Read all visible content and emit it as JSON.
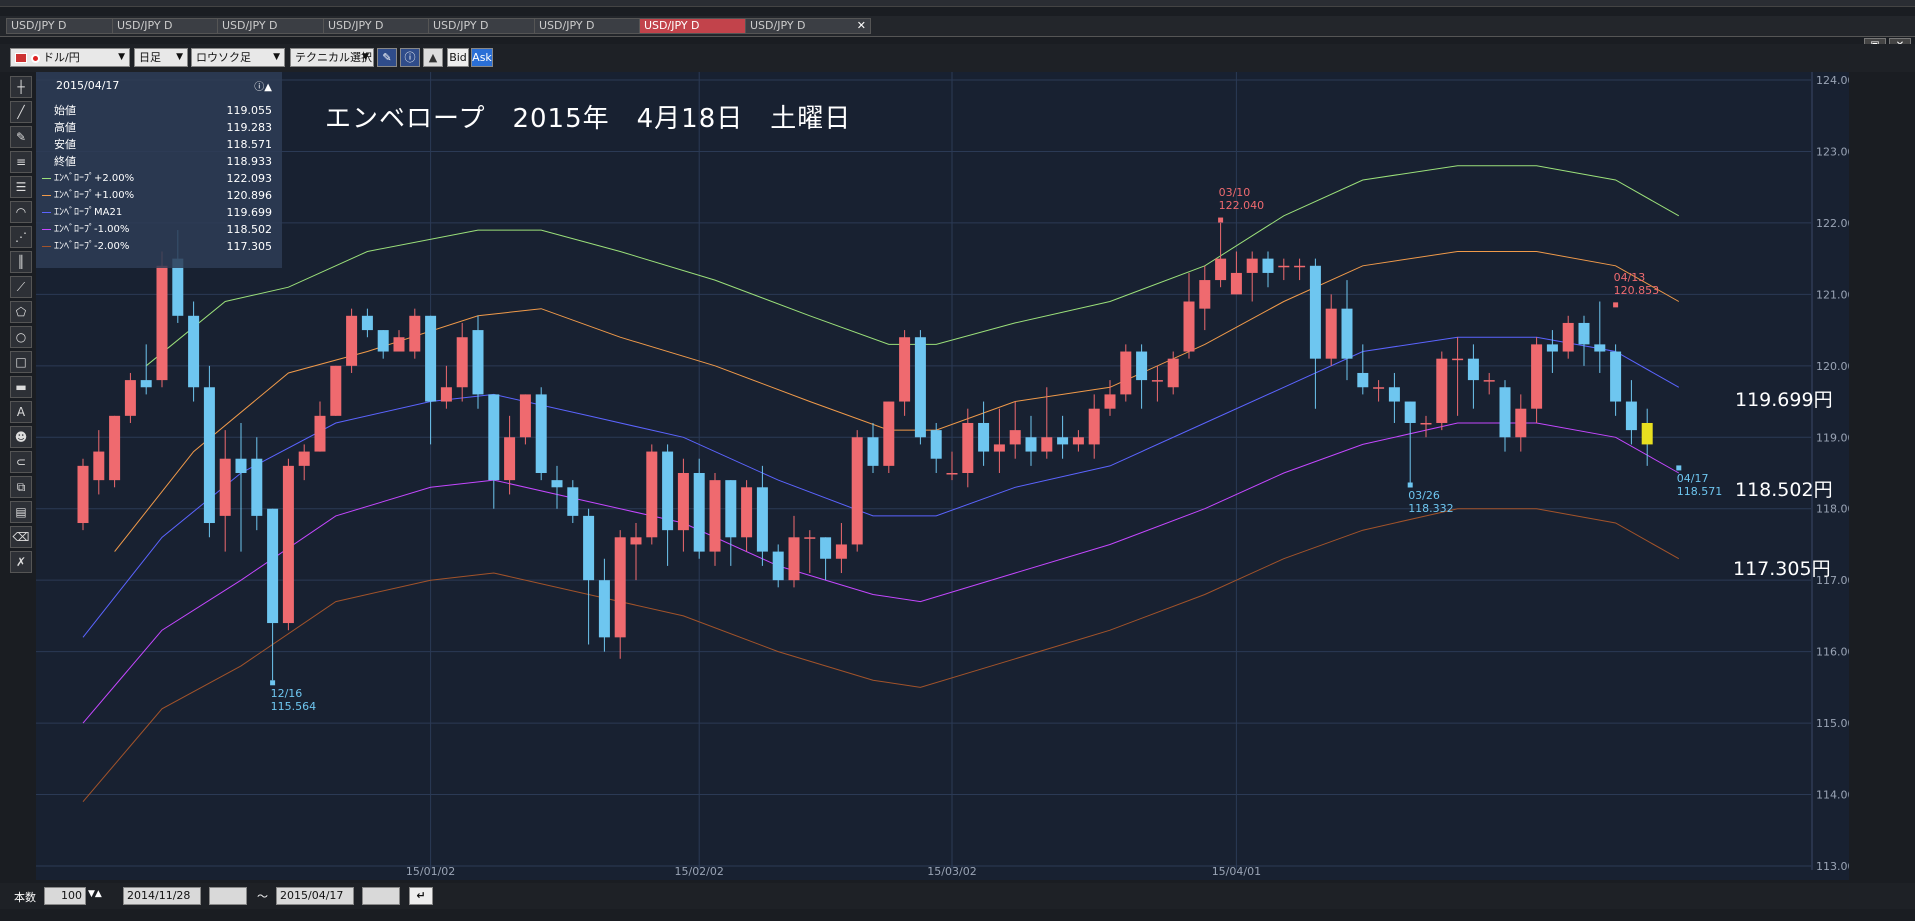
{
  "tabs": [
    {
      "label": "USD/JPY D",
      "active": false
    },
    {
      "label": "USD/JPY D",
      "active": false
    },
    {
      "label": "USD/JPY D",
      "active": false
    },
    {
      "label": "USD/JPY D",
      "active": false
    },
    {
      "label": "USD/JPY D",
      "active": false
    },
    {
      "label": "USD/JPY D",
      "active": false
    },
    {
      "label": "USD/JPY D",
      "active": true
    },
    {
      "label": "USD/JPY D",
      "active": false
    }
  ],
  "toolbar": {
    "pair": "ドル/円",
    "timeframe": "日足",
    "chart_type": "ロウソク足",
    "technical": "テクニカル選択",
    "bid": "Bid",
    "ask": "Ask"
  },
  "info": {
    "date": "2015/04/17",
    "rows": [
      {
        "label": "始値",
        "value": "119.055",
        "color": ""
      },
      {
        "label": "高値",
        "value": "119.283",
        "color": ""
      },
      {
        "label": "安値",
        "value": "118.571",
        "color": ""
      },
      {
        "label": "終値",
        "value": "118.933",
        "color": ""
      },
      {
        "label": "ｴﾝﾍﾞﾛｰﾌﾟ+2.00%",
        "value": "122.093",
        "color": "#9be07a"
      },
      {
        "label": "ｴﾝﾍﾞﾛｰﾌﾟ+1.00%",
        "value": "120.896",
        "color": "#f09a4a"
      },
      {
        "label": "ｴﾝﾍﾞﾛｰﾌﾟMA21",
        "value": "119.699",
        "color": "#5b64ff"
      },
      {
        "label": "ｴﾝﾍﾞﾛｰﾌﾟ-1.00%",
        "value": "118.502",
        "color": "#c447ff"
      },
      {
        "label": "ｴﾝﾍﾞﾛｰﾌﾟ-2.00%",
        "value": "117.305",
        "color": "#a2532a"
      }
    ]
  },
  "title": "エンベロープ　2015年　4月18日　土曜日",
  "price_labels": [
    "119.699円",
    "118.502円",
    "117.305円"
  ],
  "bottom": {
    "count_label": "本数",
    "count": "100",
    "from": "2014/11/28",
    "tilde": "〜",
    "to": "2015/04/17"
  },
  "chart_data": {
    "type": "candlestick",
    "ylim": [
      113,
      124
    ],
    "y_ticks": [
      "124.00",
      "123.00",
      "122.00",
      "121.00",
      "120.00",
      "119.00",
      "118.00",
      "117.00",
      "116.00",
      "115.00",
      "114.00",
      "113.00"
    ],
    "x_ticks": [
      "15/01/02",
      "15/02/02",
      "15/03/02",
      "15/04/01"
    ],
    "candles": [
      {
        "o": 117.8,
        "c": 118.6,
        "h": 118.7,
        "l": 117.7
      },
      {
        "o": 118.4,
        "c": 118.8,
        "h": 119.1,
        "l": 118.2
      },
      {
        "o": 118.4,
        "c": 119.3,
        "h": 119.3,
        "l": 118.3
      },
      {
        "o": 119.3,
        "c": 119.8,
        "h": 119.9,
        "l": 119.2
      },
      {
        "o": 119.8,
        "c": 119.7,
        "h": 120.3,
        "l": 119.6
      },
      {
        "o": 119.8,
        "c": 121.4,
        "h": 121.6,
        "l": 119.7
      },
      {
        "o": 121.5,
        "c": 120.7,
        "h": 121.9,
        "l": 120.6
      },
      {
        "o": 120.7,
        "c": 119.7,
        "h": 120.9,
        "l": 119.5
      },
      {
        "o": 119.7,
        "c": 117.8,
        "h": 120.0,
        "l": 117.6
      },
      {
        "o": 117.9,
        "c": 118.7,
        "h": 119.1,
        "l": 117.4
      },
      {
        "o": 118.7,
        "c": 118.5,
        "h": 119.2,
        "l": 117.4
      },
      {
        "o": 118.7,
        "c": 117.9,
        "h": 119.0,
        "l": 117.7
      },
      {
        "o": 118.0,
        "c": 116.4,
        "h": 118.0,
        "l": 115.6
      },
      {
        "o": 116.4,
        "c": 118.6,
        "h": 118.7,
        "l": 116.3
      },
      {
        "o": 118.6,
        "c": 118.8,
        "h": 118.9,
        "l": 118.4
      },
      {
        "o": 118.8,
        "c": 119.3,
        "h": 119.5,
        "l": 118.8
      },
      {
        "o": 119.3,
        "c": 120.0,
        "h": 120.0,
        "l": 119.3
      },
      {
        "o": 120.0,
        "c": 120.7,
        "h": 120.8,
        "l": 119.9
      },
      {
        "o": 120.7,
        "c": 120.5,
        "h": 120.8,
        "l": 120.4
      },
      {
        "o": 120.5,
        "c": 120.2,
        "h": 120.5,
        "l": 120.1
      },
      {
        "o": 120.2,
        "c": 120.4,
        "h": 120.5,
        "l": 120.2
      },
      {
        "o": 120.2,
        "c": 120.7,
        "h": 120.8,
        "l": 120.1
      },
      {
        "o": 120.7,
        "c": 119.5,
        "h": 120.7,
        "l": 118.9
      },
      {
        "o": 119.5,
        "c": 119.7,
        "h": 120.0,
        "l": 119.4
      },
      {
        "o": 119.7,
        "c": 120.4,
        "h": 120.6,
        "l": 119.5
      },
      {
        "o": 120.5,
        "c": 119.6,
        "h": 120.7,
        "l": 119.4
      },
      {
        "o": 119.6,
        "c": 118.4,
        "h": 119.6,
        "l": 118.0
      },
      {
        "o": 118.4,
        "c": 119.0,
        "h": 119.3,
        "l": 118.2
      },
      {
        "o": 119.0,
        "c": 119.6,
        "h": 119.6,
        "l": 118.9
      },
      {
        "o": 119.6,
        "c": 118.5,
        "h": 119.7,
        "l": 118.4
      },
      {
        "o": 118.4,
        "c": 118.3,
        "h": 118.6,
        "l": 118.0
      },
      {
        "o": 118.3,
        "c": 117.9,
        "h": 118.4,
        "l": 117.8
      },
      {
        "o": 117.9,
        "c": 117.0,
        "h": 118.0,
        "l": 116.1
      },
      {
        "o": 117.0,
        "c": 116.2,
        "h": 117.3,
        "l": 116.0
      },
      {
        "o": 116.2,
        "c": 117.6,
        "h": 117.7,
        "l": 115.9
      },
      {
        "o": 117.5,
        "c": 117.6,
        "h": 117.8,
        "l": 117.0
      },
      {
        "o": 117.6,
        "c": 118.8,
        "h": 118.9,
        "l": 117.5
      },
      {
        "o": 118.8,
        "c": 117.7,
        "h": 118.9,
        "l": 117.2
      },
      {
        "o": 117.7,
        "c": 118.5,
        "h": 118.7,
        "l": 117.4
      },
      {
        "o": 118.5,
        "c": 117.4,
        "h": 118.7,
        "l": 117.3
      },
      {
        "o": 117.4,
        "c": 118.4,
        "h": 118.5,
        "l": 117.2
      },
      {
        "o": 118.4,
        "c": 117.6,
        "h": 118.4,
        "l": 117.2
      },
      {
        "o": 117.6,
        "c": 118.3,
        "h": 118.4,
        "l": 117.4
      },
      {
        "o": 118.3,
        "c": 117.4,
        "h": 118.6,
        "l": 117.2
      },
      {
        "o": 117.4,
        "c": 117.0,
        "h": 117.5,
        "l": 116.9
      },
      {
        "o": 117.0,
        "c": 117.6,
        "h": 117.9,
        "l": 116.9
      },
      {
        "o": 117.6,
        "c": 117.6,
        "h": 117.7,
        "l": 117.1
      },
      {
        "o": 117.6,
        "c": 117.3,
        "h": 117.6,
        "l": 117.0
      },
      {
        "o": 117.3,
        "c": 117.5,
        "h": 117.8,
        "l": 117.1
      },
      {
        "o": 117.5,
        "c": 119.0,
        "h": 119.1,
        "l": 117.4
      },
      {
        "o": 119.0,
        "c": 118.6,
        "h": 119.2,
        "l": 118.5
      },
      {
        "o": 118.6,
        "c": 119.5,
        "h": 119.5,
        "l": 118.5
      },
      {
        "o": 119.5,
        "c": 120.4,
        "h": 120.5,
        "l": 119.3
      },
      {
        "o": 120.4,
        "c": 119.0,
        "h": 120.5,
        "l": 118.9
      },
      {
        "o": 119.1,
        "c": 118.7,
        "h": 119.2,
        "l": 118.5
      },
      {
        "o": 118.5,
        "c": 118.5,
        "h": 118.8,
        "l": 118.4
      },
      {
        "o": 118.5,
        "c": 119.2,
        "h": 119.4,
        "l": 118.3
      },
      {
        "o": 119.2,
        "c": 118.8,
        "h": 119.5,
        "l": 118.6
      },
      {
        "o": 118.8,
        "c": 118.9,
        "h": 119.4,
        "l": 118.5
      },
      {
        "o": 118.9,
        "c": 119.1,
        "h": 119.5,
        "l": 118.7
      },
      {
        "o": 119.0,
        "c": 118.8,
        "h": 119.3,
        "l": 118.6
      },
      {
        "o": 118.8,
        "c": 119.0,
        "h": 119.7,
        "l": 118.7
      },
      {
        "o": 119.0,
        "c": 118.9,
        "h": 119.3,
        "l": 118.7
      },
      {
        "o": 118.9,
        "c": 119.0,
        "h": 119.1,
        "l": 118.8
      },
      {
        "o": 118.9,
        "c": 119.4,
        "h": 119.6,
        "l": 118.7
      },
      {
        "o": 119.4,
        "c": 119.6,
        "h": 119.8,
        "l": 119.3
      },
      {
        "o": 119.6,
        "c": 120.2,
        "h": 120.3,
        "l": 119.5
      },
      {
        "o": 120.2,
        "c": 119.8,
        "h": 120.3,
        "l": 119.4
      },
      {
        "o": 119.8,
        "c": 119.8,
        "h": 120.0,
        "l": 119.5
      },
      {
        "o": 119.7,
        "c": 120.1,
        "h": 120.2,
        "l": 119.6
      },
      {
        "o": 120.2,
        "c": 120.9,
        "h": 121.3,
        "l": 120.1
      },
      {
        "o": 120.8,
        "c": 121.2,
        "h": 121.4,
        "l": 120.5
      },
      {
        "o": 121.2,
        "c": 121.5,
        "h": 122.0,
        "l": 121.1
      },
      {
        "o": 121.0,
        "c": 121.3,
        "h": 121.6,
        "l": 121.0
      },
      {
        "o": 121.3,
        "c": 121.5,
        "h": 121.6,
        "l": 120.9
      },
      {
        "o": 121.5,
        "c": 121.3,
        "h": 121.6,
        "l": 121.1
      },
      {
        "o": 121.4,
        "c": 121.4,
        "h": 121.5,
        "l": 121.2
      },
      {
        "o": 121.4,
        "c": 121.4,
        "h": 121.5,
        "l": 121.2
      },
      {
        "o": 121.4,
        "c": 120.1,
        "h": 121.5,
        "l": 119.4
      },
      {
        "o": 120.1,
        "c": 120.8,
        "h": 121.0,
        "l": 120.0
      },
      {
        "o": 120.8,
        "c": 120.1,
        "h": 121.2,
        "l": 119.8
      },
      {
        "o": 119.9,
        "c": 119.7,
        "h": 120.3,
        "l": 119.6
      },
      {
        "o": 119.7,
        "c": 119.7,
        "h": 119.8,
        "l": 119.5
      },
      {
        "o": 119.7,
        "c": 119.5,
        "h": 119.9,
        "l": 119.2
      },
      {
        "o": 119.5,
        "c": 119.2,
        "h": 119.5,
        "l": 118.3
      },
      {
        "o": 119.2,
        "c": 119.2,
        "h": 119.3,
        "l": 119.0
      },
      {
        "o": 119.2,
        "c": 120.1,
        "h": 120.2,
        "l": 119.1
      },
      {
        "o": 120.1,
        "c": 120.1,
        "h": 120.4,
        "l": 119.3
      },
      {
        "o": 120.1,
        "c": 119.8,
        "h": 120.3,
        "l": 119.4
      },
      {
        "o": 119.8,
        "c": 119.8,
        "h": 119.9,
        "l": 119.6
      },
      {
        "o": 119.7,
        "c": 119.0,
        "h": 119.8,
        "l": 118.8
      },
      {
        "o": 119.0,
        "c": 119.4,
        "h": 119.6,
        "l": 118.8
      },
      {
        "o": 119.4,
        "c": 120.3,
        "h": 120.4,
        "l": 119.2
      },
      {
        "o": 120.3,
        "c": 120.2,
        "h": 120.5,
        "l": 119.9
      },
      {
        "o": 120.2,
        "c": 120.6,
        "h": 120.7,
        "l": 120.1
      },
      {
        "o": 120.6,
        "c": 120.3,
        "h": 120.7,
        "l": 120.0
      },
      {
        "o": 120.3,
        "c": 120.2,
        "h": 120.9,
        "l": 119.9
      },
      {
        "o": 120.2,
        "c": 119.5,
        "h": 120.3,
        "l": 119.3
      },
      {
        "o": 119.5,
        "c": 119.1,
        "h": 119.8,
        "l": 118.9
      },
      {
        "o": 119.2,
        "c": 118.9,
        "h": 119.4,
        "l": 118.6
      }
    ],
    "envelopes": [
      {
        "name": "ｴﾝﾍﾞﾛｰﾌﾟ+2.00%",
        "color": "#9be07a",
        "points": [
          [
            4,
            120.0
          ],
          [
            9,
            120.9
          ],
          [
            13,
            121.1
          ],
          [
            18,
            121.6
          ],
          [
            25,
            121.9
          ],
          [
            29,
            121.9
          ],
          [
            34,
            121.6
          ],
          [
            40,
            121.2
          ],
          [
            46,
            120.7
          ],
          [
            51,
            120.3
          ],
          [
            54,
            120.3
          ],
          [
            59,
            120.6
          ],
          [
            65,
            120.9
          ],
          [
            71,
            121.4
          ],
          [
            76,
            122.1
          ],
          [
            81,
            122.6
          ],
          [
            87,
            122.8
          ],
          [
            92,
            122.8
          ],
          [
            97,
            122.6
          ],
          [
            101,
            122.1
          ]
        ]
      },
      {
        "name": "ｴﾝﾍﾞﾛｰﾌﾟ+1.00%",
        "color": "#f09a4a",
        "points": [
          [
            2,
            117.4
          ],
          [
            7,
            118.8
          ],
          [
            13,
            119.9
          ],
          [
            18,
            120.2
          ],
          [
            25,
            120.7
          ],
          [
            29,
            120.8
          ],
          [
            34,
            120.4
          ],
          [
            40,
            120.0
          ],
          [
            46,
            119.5
          ],
          [
            51,
            119.1
          ],
          [
            54,
            119.1
          ],
          [
            59,
            119.5
          ],
          [
            65,
            119.7
          ],
          [
            71,
            120.3
          ],
          [
            76,
            120.9
          ],
          [
            81,
            121.4
          ],
          [
            87,
            121.6
          ],
          [
            92,
            121.6
          ],
          [
            97,
            121.4
          ],
          [
            101,
            120.9
          ]
        ]
      },
      {
        "name": "ｴﾝﾍﾞﾛｰﾌﾟMA21",
        "color": "#5b64ff",
        "points": [
          [
            0,
            116.2
          ],
          [
            5,
            117.6
          ],
          [
            10,
            118.5
          ],
          [
            16,
            119.2
          ],
          [
            22,
            119.5
          ],
          [
            26,
            119.6
          ],
          [
            32,
            119.3
          ],
          [
            38,
            119.0
          ],
          [
            44,
            118.4
          ],
          [
            50,
            117.9
          ],
          [
            54,
            117.9
          ],
          [
            59,
            118.3
          ],
          [
            65,
            118.6
          ],
          [
            71,
            119.2
          ],
          [
            76,
            119.7
          ],
          [
            81,
            120.2
          ],
          [
            87,
            120.4
          ],
          [
            92,
            120.4
          ],
          [
            97,
            120.2
          ],
          [
            101,
            119.7
          ]
        ]
      },
      {
        "name": "ｴﾝﾍﾞﾛｰﾌﾟ-1.00%",
        "color": "#c447ff",
        "points": [
          [
            0,
            115.0
          ],
          [
            5,
            116.3
          ],
          [
            10,
            117.0
          ],
          [
            16,
            117.9
          ],
          [
            22,
            118.3
          ],
          [
            26,
            118.4
          ],
          [
            32,
            118.1
          ],
          [
            38,
            117.8
          ],
          [
            44,
            117.2
          ],
          [
            50,
            116.8
          ],
          [
            53,
            116.7
          ],
          [
            59,
            117.1
          ],
          [
            65,
            117.5
          ],
          [
            71,
            118.0
          ],
          [
            76,
            118.5
          ],
          [
            81,
            118.9
          ],
          [
            87,
            119.2
          ],
          [
            92,
            119.2
          ],
          [
            97,
            119.0
          ],
          [
            101,
            118.5
          ]
        ]
      },
      {
        "name": "ｴﾝﾍﾞﾛｰﾌﾟ-2.00%",
        "color": "#a2532a",
        "points": [
          [
            0,
            113.9
          ],
          [
            5,
            115.2
          ],
          [
            10,
            115.8
          ],
          [
            16,
            116.7
          ],
          [
            22,
            117.0
          ],
          [
            26,
            117.1
          ],
          [
            32,
            116.8
          ],
          [
            38,
            116.5
          ],
          [
            44,
            116.0
          ],
          [
            50,
            115.6
          ],
          [
            53,
            115.5
          ],
          [
            59,
            115.9
          ],
          [
            65,
            116.3
          ],
          [
            71,
            116.8
          ],
          [
            76,
            117.3
          ],
          [
            81,
            117.7
          ],
          [
            87,
            118.0
          ],
          [
            92,
            118.0
          ],
          [
            97,
            117.8
          ],
          [
            101,
            117.3
          ]
        ]
      }
    ],
    "annotations": [
      {
        "date": "12/16",
        "value": "115.564",
        "i": 12,
        "y": 115.564,
        "color": "#6ec6f0",
        "pos": "below"
      },
      {
        "date": "03/10",
        "value": "122.040",
        "i": 72,
        "y": 122.04,
        "color": "#ef6a6f",
        "pos": "above"
      },
      {
        "date": "03/26",
        "value": "118.332",
        "i": 84,
        "y": 118.332,
        "color": "#6ec6f0",
        "pos": "below"
      },
      {
        "date": "04/13",
        "value": "120.853",
        "i": 97,
        "y": 120.853,
        "color": "#ef6a6f",
        "pos": "above"
      },
      {
        "date": "04/17",
        "value": "118.571",
        "i": 101,
        "y": 118.571,
        "color": "#6ec6f0",
        "pos": "below"
      }
    ],
    "colors": {
      "up": "#ef6a6f",
      "down": "#6ec6f0",
      "grid": "#2b3a55",
      "bg": "#182131"
    }
  }
}
